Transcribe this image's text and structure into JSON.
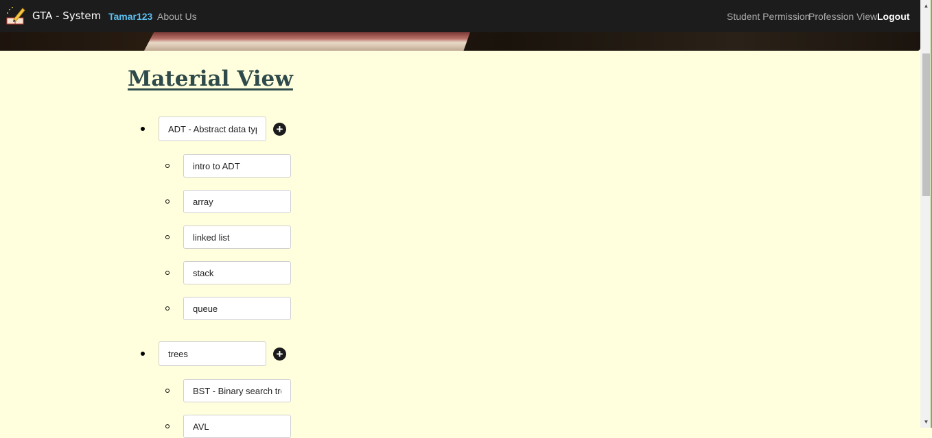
{
  "navbar": {
    "brand": "GTA - System",
    "user": "Tamar123",
    "about": "About Us",
    "student_permission": "Student Permission",
    "profession_view": "Profession View",
    "logout": "Logout"
  },
  "page": {
    "title": "Material View"
  },
  "topics": [
    {
      "value": "ADT - Abstract data type",
      "add_icon": "plus-circle-icon",
      "subtopics": [
        "intro to ADT",
        "array",
        "linked list",
        "stack",
        "queue"
      ]
    },
    {
      "value": "trees",
      "add_icon": "plus-circle-icon",
      "subtopics": [
        "BST - Binary search tree",
        "AVL"
      ]
    }
  ],
  "colors": {
    "background": "#ffffdd",
    "navbar": "#1c1c1c",
    "user_link": "#5bc0f0",
    "title": "#2f4a4a"
  }
}
